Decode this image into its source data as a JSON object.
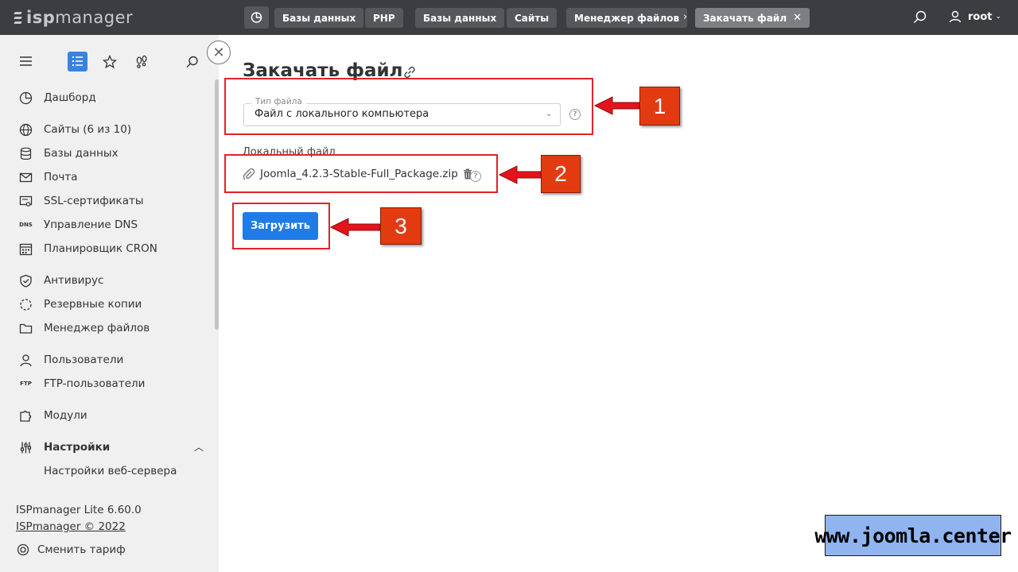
{
  "app": {
    "logo_prefix": "isp",
    "logo_suffix": "manager"
  },
  "breadcrumbs": [
    {
      "label": "Базы данных"
    },
    {
      "label": "PHP"
    },
    {
      "label": "Базы данных"
    },
    {
      "label": "Сайты"
    },
    {
      "label": "Менеджер файлов"
    },
    {
      "label": "Закачать файл"
    }
  ],
  "breadcrumb_separator": "›",
  "breadcrumb_close": "✕",
  "user": {
    "name": "root",
    "chevron": "⌄"
  },
  "sidebar": {
    "items": [
      {
        "label": "Дашборд",
        "icon": "dashboard-icon"
      },
      {
        "label": "Сайты (6 из 10)",
        "icon": "globe-icon"
      },
      {
        "label": "Базы данных",
        "icon": "database-icon"
      },
      {
        "label": "Почта",
        "icon": "mail-icon"
      },
      {
        "label": "SSL-сертификаты",
        "icon": "certificate-icon"
      },
      {
        "label": "Управление DNS",
        "icon": "dns-icon"
      },
      {
        "label": "Планировщик CRON",
        "icon": "calendar-icon"
      },
      {
        "label": "Антивирус",
        "icon": "shield-icon"
      },
      {
        "label": "Резервные копии",
        "icon": "backup-icon"
      },
      {
        "label": "Менеджер файлов",
        "icon": "folder-icon"
      },
      {
        "label": "Пользователи",
        "icon": "user-icon"
      },
      {
        "label": "FTP-пользователи",
        "icon": "ftp-icon"
      },
      {
        "label": "Модули",
        "icon": "puzzle-icon"
      },
      {
        "label": "Настройки",
        "icon": "sliders-icon"
      }
    ],
    "sub_items": [
      {
        "label": "Настройки веб-сервера"
      }
    ],
    "dns_icon_text": "DNS",
    "ftp_icon_text": "FTP",
    "footer": {
      "version": "ISPmanager Lite 6.60.0",
      "copyright": "ISPmanager © 2022",
      "change_plan": "Сменить тариф"
    }
  },
  "main": {
    "close_symbol": "✕",
    "title": "Закачать файл",
    "file_type": {
      "legend": "Тип файла",
      "value": "Файл с локального компьютера",
      "chevron": "⌄"
    },
    "local_file": {
      "label": "Локальный файл",
      "filename": "Joomla_4.2.3-Stable-Full_Package.zip"
    },
    "help_symbol": "?",
    "upload_button": "Загрузить"
  },
  "annotations": {
    "badges": [
      "1",
      "2",
      "3"
    ],
    "color": "#e2222a"
  },
  "watermark": "www.joomla.center"
}
